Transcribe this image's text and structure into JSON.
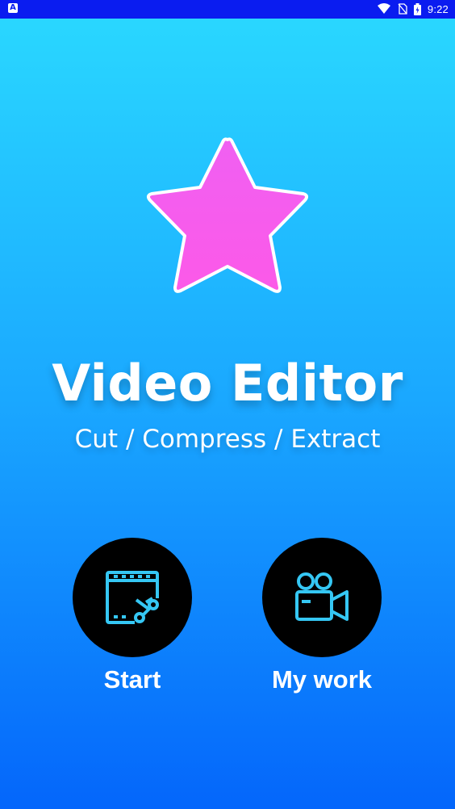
{
  "status_bar": {
    "left_icon": "A",
    "time": "9:22",
    "icons": [
      "wifi-icon",
      "no-sim-icon",
      "battery-charging-icon"
    ]
  },
  "hero": {
    "logo_icon": "star-icon",
    "title": "Video Editor",
    "subtitle": "Cut / Compress / Extract"
  },
  "actions": [
    {
      "label": "Start",
      "icon": "video-cut-icon"
    },
    {
      "label": "My work",
      "icon": "video-camera-icon"
    }
  ],
  "colors": {
    "background_top": "#2ad9ff",
    "background_bottom": "#0466fb",
    "status_bar": "#0a1cf0",
    "star_top": "#f060f2",
    "star_bottom": "#fc59e8",
    "icon_stroke": "#35c7f4",
    "button": "#000000"
  }
}
